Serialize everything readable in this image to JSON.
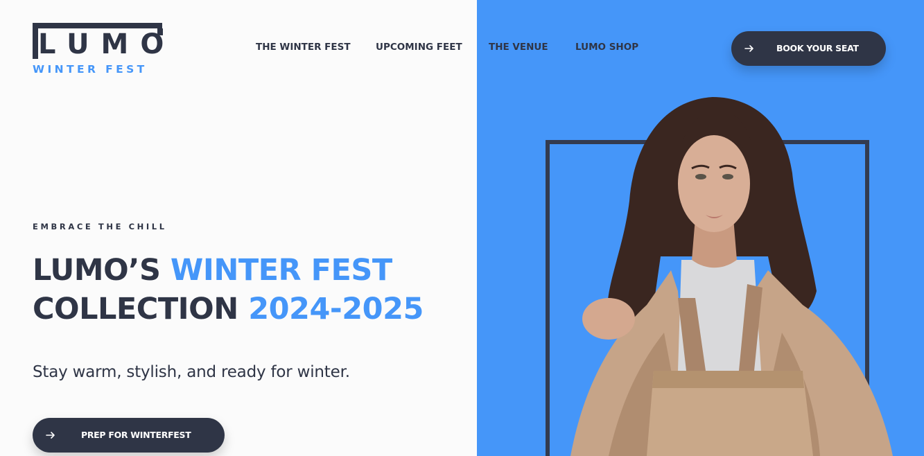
{
  "brand": {
    "logo_word": "LUMO",
    "logo_sub": "WINTER FEST"
  },
  "nav": {
    "items": [
      {
        "label": "THE WINTER FEST"
      },
      {
        "label": "UPCOMING FEET"
      },
      {
        "label": "THE VENUE"
      },
      {
        "label": "LUMO SHOP"
      }
    ],
    "cta_label": "BOOK YOUR SEAT"
  },
  "hero": {
    "eyebrow": "EMBRACE THE CHILL",
    "headline_line1_dark": "LUMO’S",
    "headline_line1_accent": "WINTER FEST",
    "headline_line2_dark": "COLLECTION",
    "headline_line2_accent": "2024-2025",
    "subtitle": "Stay warm, stylish, and ready for winter.",
    "cta_label": "PREP FOR WINTERFEST"
  },
  "icons": {
    "cta_arrow": "arrow-right-icon",
    "hero_image": "model-in-beige-jacket-photo"
  },
  "colors": {
    "accent_blue": "#4596f9",
    "navy": "#2f3546",
    "frame_navy": "#333b4f",
    "background": "#fbfbfb"
  }
}
